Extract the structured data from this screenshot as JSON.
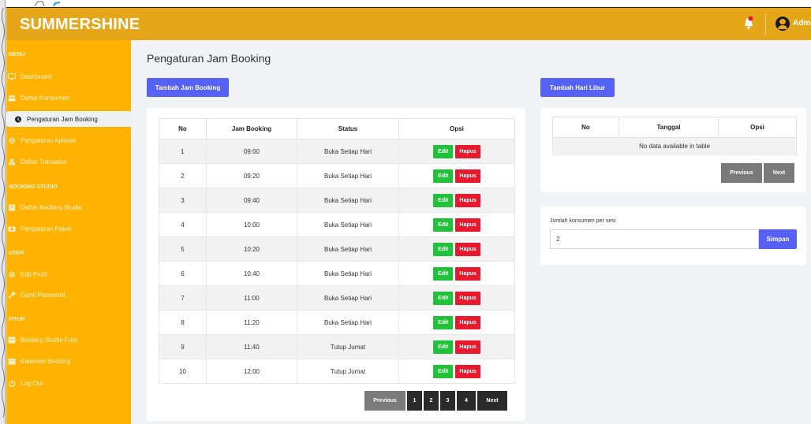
{
  "header": {
    "brand": "SUMMERSHINE",
    "user_label": "Admin"
  },
  "sidebar": {
    "sections": [
      "MENU",
      "BOOKING STUDIO",
      "USER",
      "FITUR"
    ],
    "items": [
      {
        "label": "Dashboard",
        "icon": "monitor-icon"
      },
      {
        "label": "Daftar Konsumen",
        "icon": "users-icon"
      },
      {
        "label": "Pengaturan Jam Booking",
        "icon": "clock-icon",
        "active": true
      },
      {
        "label": "Pengaturan Aplikasi",
        "icon": "gear-icon"
      },
      {
        "label": "Daftar Transaksi",
        "icon": "transaction-icon"
      },
      {
        "label": "Daftar Booking Studio",
        "icon": "list-icon"
      },
      {
        "label": "Pengaturan Paket",
        "icon": "package-icon"
      },
      {
        "label": "Edit Profil",
        "icon": "gear-icon"
      },
      {
        "label": "Ganti Password",
        "icon": "key-icon"
      },
      {
        "label": "Booking Studio Foto",
        "icon": "image-icon"
      },
      {
        "label": "Kalender Booking",
        "icon": "calendar-icon"
      },
      {
        "label": "Log Out",
        "icon": "power-icon"
      }
    ]
  },
  "main": {
    "title": "Pengaturan Jam Booking",
    "add_hour_button": "Tambah Jam Booking",
    "add_holiday_button": "Tambah Hari Libur"
  },
  "hours_table": {
    "columns": [
      "No",
      "Jam Booking",
      "Status",
      "Opsi"
    ],
    "rows": [
      {
        "no": "1",
        "time": "09:00",
        "status": "Buka Setiap Hari"
      },
      {
        "no": "2",
        "time": "09:20",
        "status": "Buka Setiap Hari"
      },
      {
        "no": "3",
        "time": "09:40",
        "status": "Buka Setiap Hari"
      },
      {
        "no": "4",
        "time": "10:00",
        "status": "Buka Setiap Hari"
      },
      {
        "no": "5",
        "time": "10:20",
        "status": "Buka Setiap Hari"
      },
      {
        "no": "6",
        "time": "10:40",
        "status": "Buka Setiap Hari"
      },
      {
        "no": "7",
        "time": "11:00",
        "status": "Buka Setiap Hari"
      },
      {
        "no": "8",
        "time": "11:20",
        "status": "Buka Setiap Hari"
      },
      {
        "no": "9",
        "time": "11:40",
        "status": "Tutup Jumat"
      },
      {
        "no": "10",
        "time": "12:00",
        "status": "Tutup Jumat"
      }
    ],
    "edit_label": "Edit",
    "delete_label": "Hapus",
    "pager": {
      "previous": "Previous",
      "pages": [
        "1",
        "2",
        "3",
        "4"
      ],
      "next": "Next"
    }
  },
  "holiday_table": {
    "columns": [
      "No",
      "Tanggal",
      "Opsi"
    ],
    "empty_text": "No data available in table",
    "pager": {
      "previous": "Previous",
      "next": "Next"
    }
  },
  "session_form": {
    "label": "Jumlah konsumen per sesi",
    "value": "2",
    "save_label": "Simpan"
  },
  "colors": {
    "header": "#e6a61a",
    "sidebar": "#ffb300",
    "primary": "#5661f5",
    "success": "#21c13a",
    "danger": "#e8192c",
    "dark": "#2a2a2a"
  }
}
